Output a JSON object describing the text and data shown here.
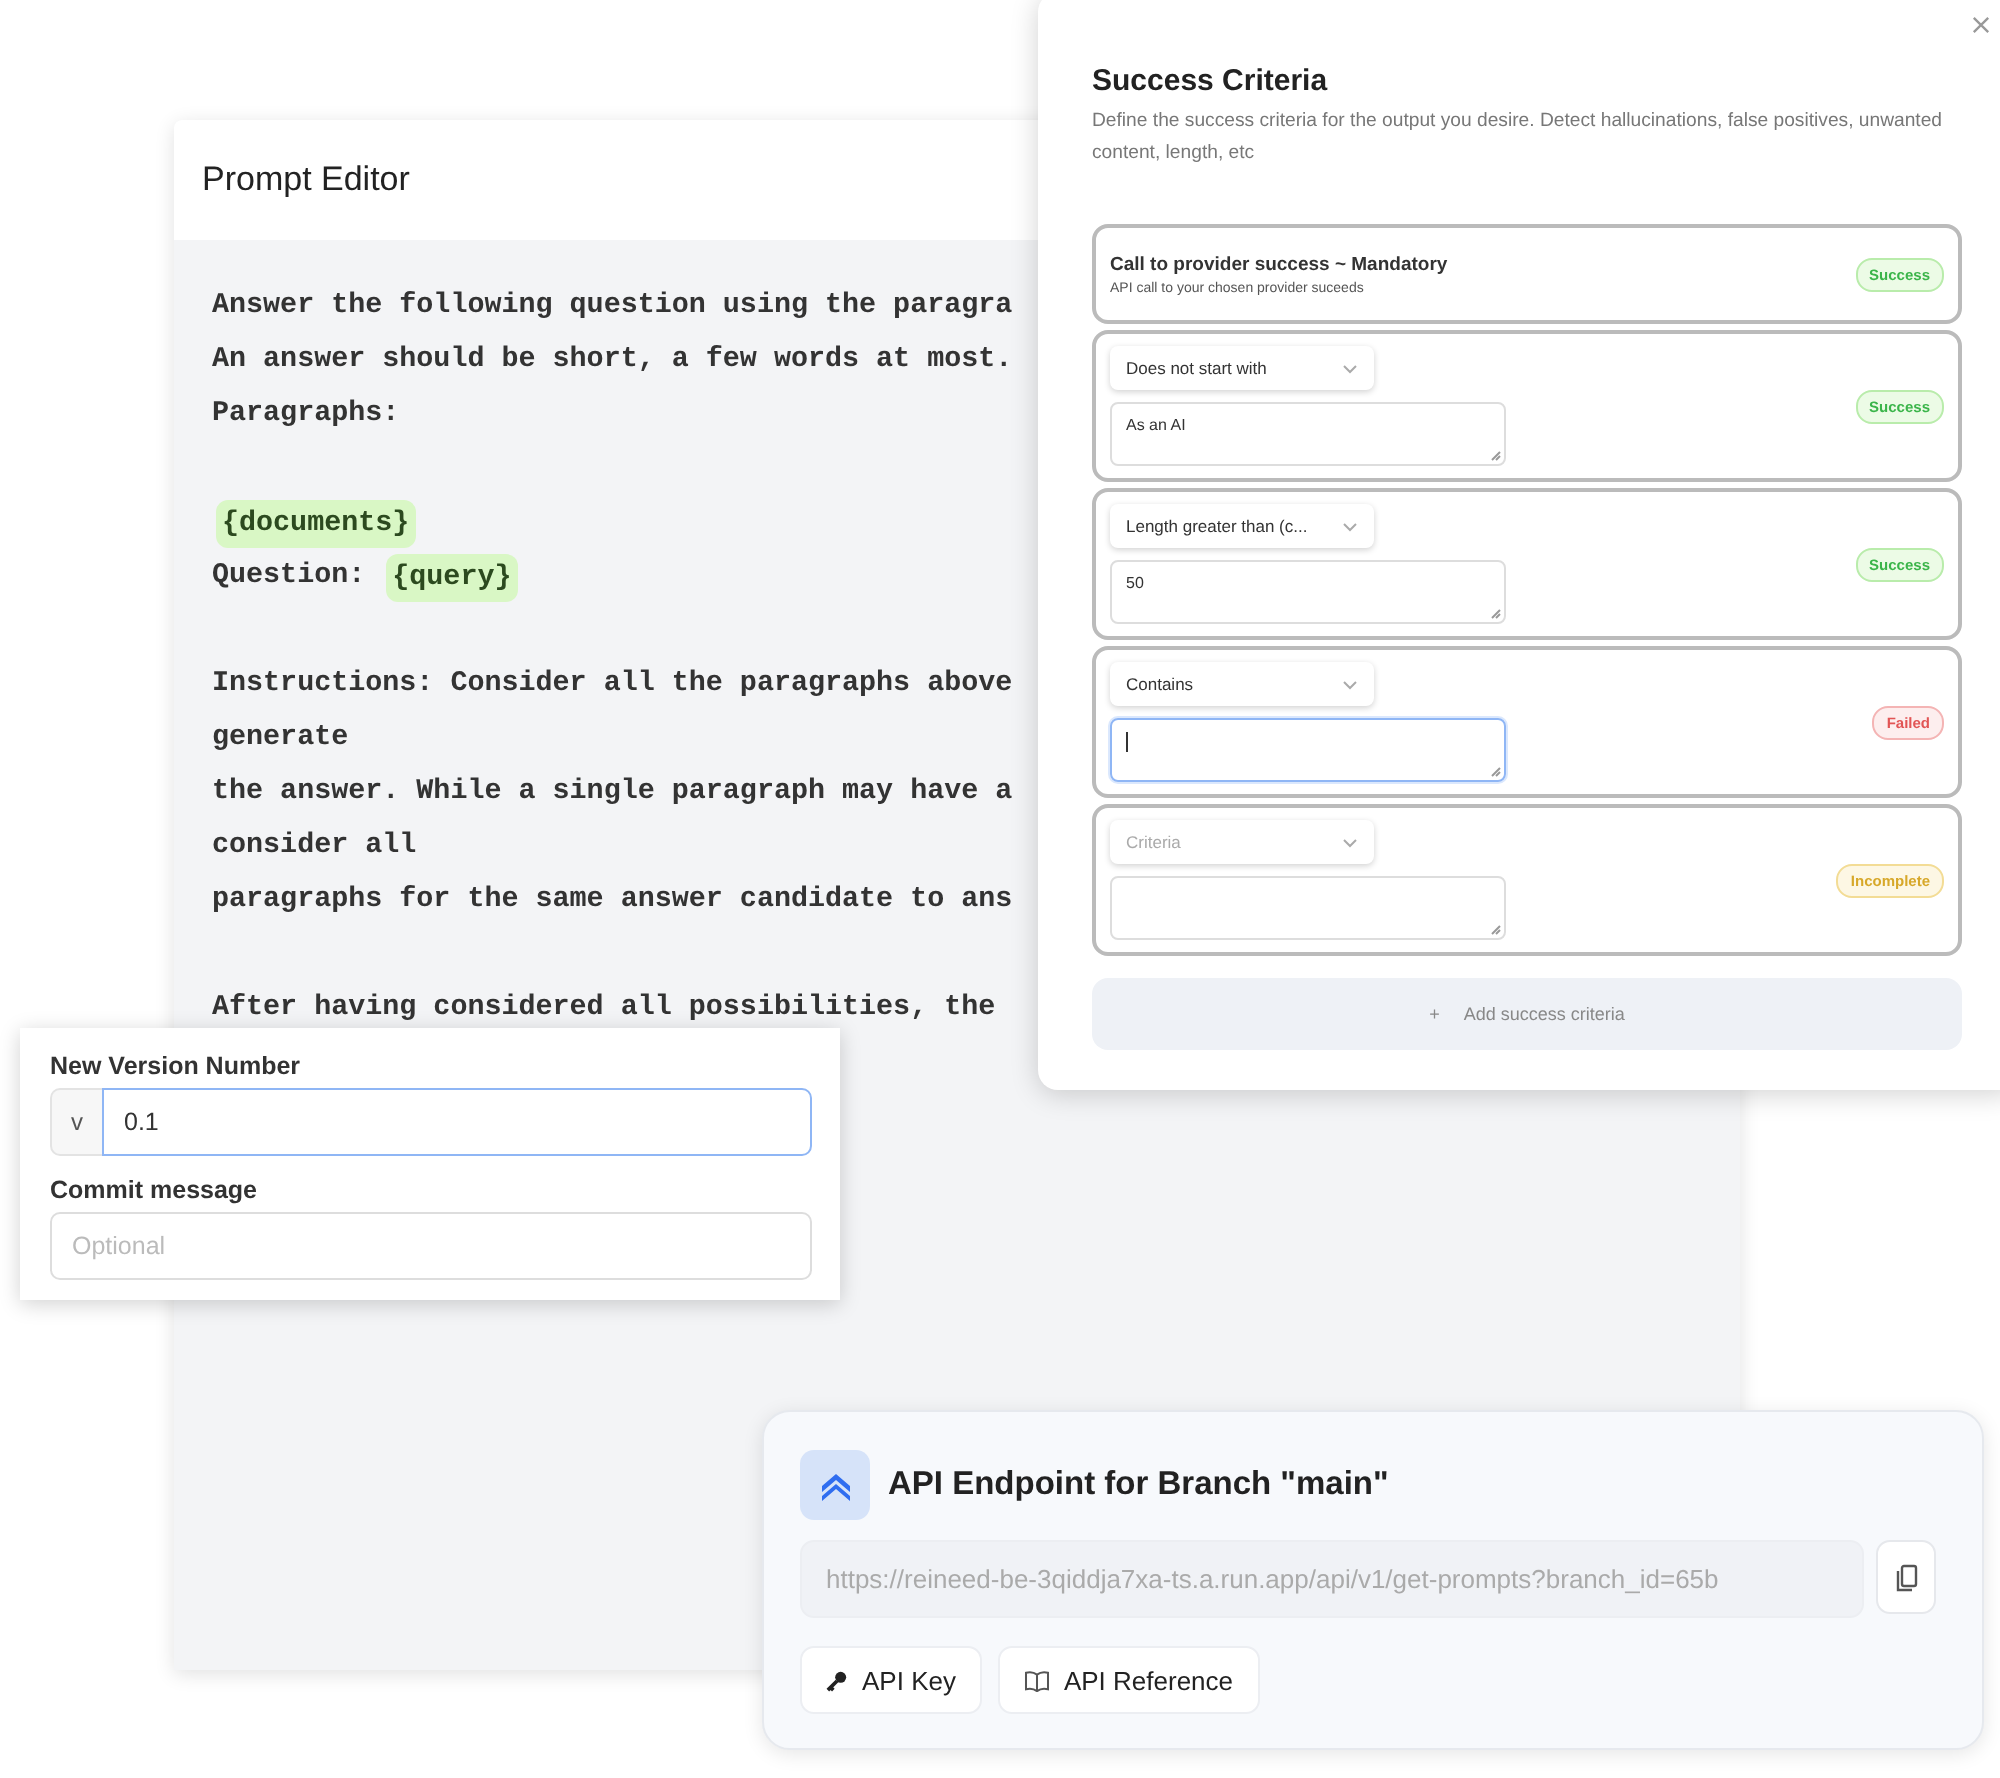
{
  "prompt_editor": {
    "title": "Prompt Editor",
    "lines": [
      {
        "kind": "text",
        "segments": [
          {
            "kind": "text",
            "text": "Answer the following question using the paragra"
          }
        ]
      },
      {
        "kind": "text",
        "segments": [
          {
            "kind": "text",
            "text": "An answer should be short, a few words at most."
          }
        ]
      },
      {
        "kind": "text",
        "segments": [
          {
            "kind": "text",
            "text": "Paragraphs:"
          }
        ]
      },
      {
        "kind": "blank"
      },
      {
        "kind": "text",
        "segments": [
          {
            "kind": "variable",
            "text": "{documents}"
          }
        ]
      },
      {
        "kind": "text",
        "segments": [
          {
            "kind": "text",
            "text": "Question: "
          },
          {
            "kind": "variable",
            "text": "{query}"
          }
        ]
      },
      {
        "kind": "blank"
      },
      {
        "kind": "text",
        "segments": [
          {
            "kind": "text",
            "text": "Instructions: Consider all the paragraphs above"
          }
        ]
      },
      {
        "kind": "text",
        "segments": [
          {
            "kind": "text",
            "text": "generate"
          }
        ]
      },
      {
        "kind": "text",
        "segments": [
          {
            "kind": "text",
            "text": "the answer. While a single paragraph may have a"
          }
        ]
      },
      {
        "kind": "text",
        "segments": [
          {
            "kind": "text",
            "text": "consider all"
          }
        ]
      },
      {
        "kind": "text",
        "segments": [
          {
            "kind": "text",
            "text": "paragraphs for the same answer candidate to ans"
          }
        ]
      },
      {
        "kind": "blank"
      },
      {
        "kind": "text",
        "segments": [
          {
            "kind": "text",
            "text": "After having considered all possibilities, the"
          }
        ]
      }
    ]
  },
  "success_criteria": {
    "title": "Success Criteria",
    "description": "Define the success criteria for the output you desire. Detect hallucinations, false positives, unwanted content, length, etc",
    "criteria": [
      {
        "kind": "fixed",
        "title": "Call to provider success ~ Mandatory",
        "subtitle": "API call to your chosen provider suceeds",
        "status": {
          "kind": "success",
          "label": "Success"
        }
      },
      {
        "kind": "rule",
        "operator": "Does not start with",
        "value": "As an AI",
        "focused": false,
        "status": {
          "kind": "success",
          "label": "Success"
        }
      },
      {
        "kind": "rule",
        "operator": "Length greater than (c...",
        "value": "50",
        "focused": false,
        "status": {
          "kind": "success",
          "label": "Success"
        }
      },
      {
        "kind": "rule",
        "operator": "Contains",
        "focused": true,
        "status": {
          "kind": "failed",
          "label": "Failed"
        }
      },
      {
        "kind": "rule",
        "operator_placeholder": "Criteria",
        "focused": false,
        "status": {
          "kind": "incomplete",
          "label": "Incomplete"
        }
      }
    ],
    "add_button": {
      "icon": "+",
      "label": "Add success criteria"
    }
  },
  "version_form": {
    "version_label": "New Version Number",
    "version_prefix": "v",
    "version_value": "0.1",
    "version_focused": true,
    "commit_label": "Commit message",
    "commit_placeholder": "Optional"
  },
  "api_endpoint": {
    "title": "API Endpoint for Branch \"main\"",
    "url": "https://reineed-be-3qiddja7xa-ts.a.run.app/api/v1/get-prompts?branch_id=65b",
    "buttons": [
      {
        "kind": "key",
        "label": "API Key"
      },
      {
        "kind": "book",
        "label": "API Reference"
      }
    ]
  }
}
